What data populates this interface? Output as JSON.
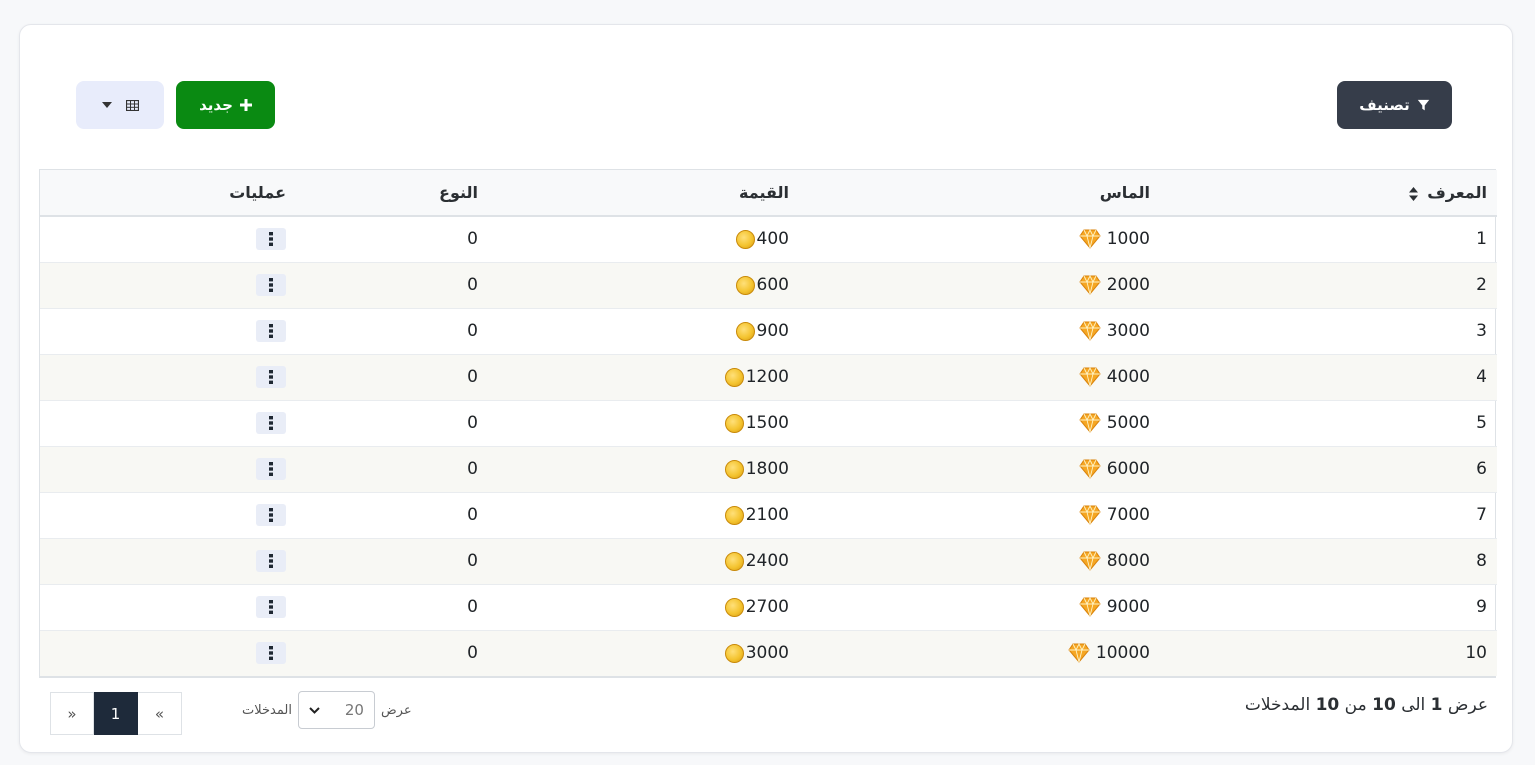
{
  "toolbar": {
    "filter_label": "تصنيف",
    "new_label": "جديد"
  },
  "table": {
    "headers": {
      "id": "المعرف",
      "diamonds": "الماس",
      "value": "القيمة",
      "type": "النوع",
      "actions": "عمليات"
    },
    "rows": [
      {
        "id": "1",
        "diamonds": "1000",
        "value": "400",
        "type": "0"
      },
      {
        "id": "2",
        "diamonds": "2000",
        "value": "600",
        "type": "0"
      },
      {
        "id": "3",
        "diamonds": "3000",
        "value": "900",
        "type": "0"
      },
      {
        "id": "4",
        "diamonds": "4000",
        "value": "1200",
        "type": "0"
      },
      {
        "id": "5",
        "diamonds": "5000",
        "value": "1500",
        "type": "0"
      },
      {
        "id": "6",
        "diamonds": "6000",
        "value": "1800",
        "type": "0"
      },
      {
        "id": "7",
        "diamonds": "7000",
        "value": "2100",
        "type": "0"
      },
      {
        "id": "8",
        "diamonds": "8000",
        "value": "2400",
        "type": "0"
      },
      {
        "id": "9",
        "diamonds": "9000",
        "value": "2700",
        "type": "0"
      },
      {
        "id": "10",
        "diamonds": "10000",
        "value": "3000",
        "type": "0"
      }
    ]
  },
  "footer": {
    "info_prefix": "عرض",
    "info_start": "1",
    "info_to": "الى",
    "info_end": "10",
    "info_of": "من",
    "info_total": "10",
    "info_suffix": "المدخلات",
    "length_prefix": "عرض",
    "length_value": "20",
    "length_suffix": "المدخلات",
    "pager_prev": "«",
    "pager_current": "1",
    "pager_next": "»"
  },
  "colors": {
    "filter_button": "#363d4a",
    "new_button": "#0a8a12",
    "columns_button": "#e8ecfb",
    "active_page": "#1e2a3a"
  },
  "icons": {
    "filter": "filter-icon",
    "new": "plus-icon",
    "columns": "table-icon",
    "dropdown": "caret-down-icon",
    "sort": "sort-icon",
    "diamond": "diamond-icon",
    "coin": "coin-icon",
    "actions": "vertical-dots-icon"
  }
}
